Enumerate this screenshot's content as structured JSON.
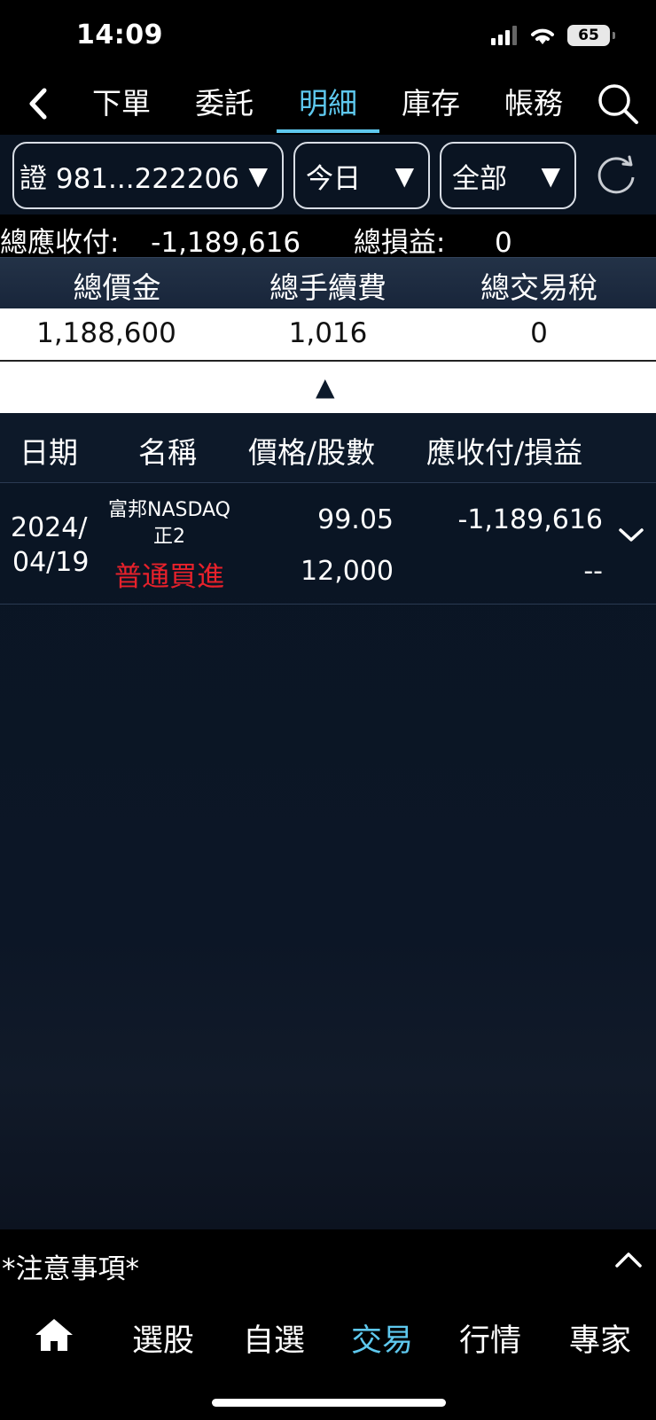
{
  "status_bar": {
    "time": "14:09",
    "battery": "65"
  },
  "nav": {
    "tabs": [
      {
        "label": "下單"
      },
      {
        "label": "委託"
      },
      {
        "label": "明細",
        "active": true
      },
      {
        "label": "庫存"
      },
      {
        "label": "帳務"
      }
    ]
  },
  "filters": {
    "account": "證 981...222206",
    "period": "今日",
    "category": "全部"
  },
  "totals": {
    "receivable_label": "總應收付:",
    "receivable_value": "-1,189,616",
    "pnl_label": "總損益:",
    "pnl_value": "0"
  },
  "summary": {
    "headers": [
      "總價金",
      "總手續費",
      "總交易稅"
    ],
    "values": [
      "1,188,600",
      "1,016",
      "0"
    ]
  },
  "list": {
    "headers": [
      "日期",
      "名稱",
      "價格/股數",
      "應收付/損益"
    ],
    "rows": [
      {
        "date_line1": "2024/",
        "date_line2": "04/19",
        "name_line1": "富邦NASDAQ",
        "name_line2": "正2",
        "trade_type": "普通買進",
        "price": "99.05",
        "shares": "12,000",
        "receivable": "-1,189,616",
        "pnl": "--"
      }
    ]
  },
  "footer": {
    "notice": "*注意事項*",
    "bottom_nav": [
      "選股",
      "自選",
      "交易",
      "行情",
      "專家"
    ],
    "active_tab": "交易"
  },
  "colors": {
    "accent": "#5ec8ee",
    "buy_red": "#e8212b",
    "background": "#0a1524"
  }
}
